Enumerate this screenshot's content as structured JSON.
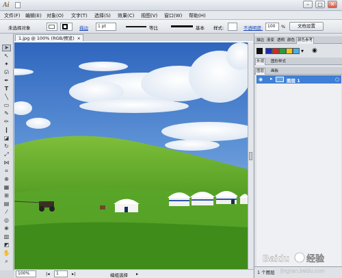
{
  "app": {
    "logo": "Ai"
  },
  "menu": [
    "文件(F)",
    "编辑(E)",
    "对象(O)",
    "文字(T)",
    "选择(S)",
    "效果(C)",
    "视图(V)",
    "窗口(W)",
    "帮助(H)"
  ],
  "control": {
    "selection": "未选择对象",
    "stroke_link": "描边",
    "stroke_weight": "1 pt",
    "profile": "等比",
    "brush": "基本",
    "style": "样式:",
    "opacity_link": "不透明度:",
    "opacity": "100",
    "opacity_unit": "%",
    "doc_settings": "文档设置"
  },
  "document": {
    "tab": "1.jpg @ 100% (RGB/预览)"
  },
  "status": {
    "zoom": "100%",
    "page": "1",
    "mode": "编组选择"
  },
  "panels": {
    "tabs_top": [
      "描边",
      "渐变",
      "透明",
      "颜色",
      "颜色参考"
    ],
    "tabs_mid": [
      "外观",
      "图形样式"
    ],
    "tabs_layers": [
      "图层",
      "画板"
    ],
    "layer_name": "图层 1",
    "layer_count": "1 个图层"
  },
  "colors": {
    "accent": "#3f7fd6",
    "sky": "#3f77c6",
    "grass": "#4f9a22"
  },
  "watermark": {
    "brand": "Baidu",
    "cn": "经验",
    "url": "jingyan.baidu.com"
  },
  "window_controls": [
    "minimize",
    "maximize",
    "close"
  ]
}
